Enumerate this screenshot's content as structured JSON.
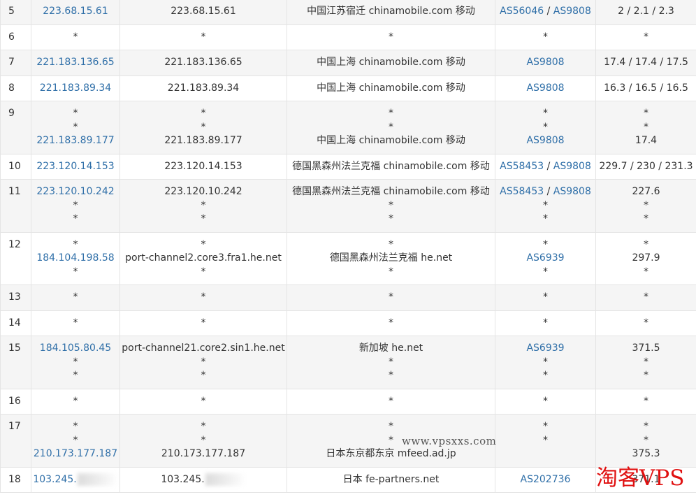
{
  "rows": [
    {
      "hop": "5",
      "ip": [
        "223.68.15.61"
      ],
      "host": [
        "223.68.15.61"
      ],
      "loc": [
        "中国江苏宿迁 chinamobile.com 移动"
      ],
      "asn": [
        [
          "AS56046",
          "AS9808"
        ]
      ],
      "time": [
        "2 / 2.1 / 2.3"
      ]
    },
    {
      "hop": "6",
      "ip": [
        "*"
      ],
      "host": [
        "*"
      ],
      "loc": [
        "*"
      ],
      "asn": [
        [
          "*"
        ]
      ],
      "time": [
        "*"
      ]
    },
    {
      "hop": "7",
      "ip": [
        "221.183.136.65"
      ],
      "host": [
        "221.183.136.65"
      ],
      "loc": [
        "中国上海 chinamobile.com 移动"
      ],
      "asn": [
        [
          "AS9808"
        ]
      ],
      "time": [
        "17.4 / 17.4 / 17.5"
      ]
    },
    {
      "hop": "8",
      "ip": [
        "221.183.89.34"
      ],
      "host": [
        "221.183.89.34"
      ],
      "loc": [
        "中国上海 chinamobile.com 移动"
      ],
      "asn": [
        [
          "AS9808"
        ]
      ],
      "time": [
        "16.3 / 16.5 / 16.5"
      ]
    },
    {
      "hop": "9",
      "ip": [
        "*",
        "*",
        "221.183.89.177"
      ],
      "host": [
        "*",
        "*",
        "221.183.89.177"
      ],
      "loc": [
        "*",
        "*",
        "中国上海 chinamobile.com 移动"
      ],
      "asn": [
        [
          "*"
        ],
        [
          "*"
        ],
        [
          "AS9808"
        ]
      ],
      "time": [
        "*",
        "*",
        "17.4"
      ]
    },
    {
      "hop": "10",
      "ip": [
        "223.120.14.153"
      ],
      "host": [
        "223.120.14.153"
      ],
      "loc": [
        "德国黑森州法兰克福 chinamobile.com 移动"
      ],
      "asn": [
        [
          "AS58453",
          "AS9808"
        ]
      ],
      "time": [
        "229.7 / 230 / 231.3"
      ]
    },
    {
      "hop": "11",
      "ip": [
        "223.120.10.242",
        "*",
        "*"
      ],
      "host": [
        "223.120.10.242",
        "*",
        "*"
      ],
      "loc": [
        "德国黑森州法兰克福 chinamobile.com 移动",
        "*",
        "*"
      ],
      "asn": [
        [
          "AS58453",
          "AS9808"
        ],
        [
          "*"
        ],
        [
          "*"
        ]
      ],
      "time": [
        "227.6",
        "*",
        "*"
      ]
    },
    {
      "hop": "12",
      "ip": [
        "*",
        "184.104.198.58",
        "*"
      ],
      "host": [
        "*",
        "port-channel2.core3.fra1.he.net",
        "*"
      ],
      "loc": [
        "*",
        "德国黑森州法兰克福 he.net",
        "*"
      ],
      "asn": [
        [
          "*"
        ],
        [
          "AS6939"
        ],
        [
          "*"
        ]
      ],
      "time": [
        "*",
        "297.9",
        "*"
      ]
    },
    {
      "hop": "13",
      "ip": [
        "*"
      ],
      "host": [
        "*"
      ],
      "loc": [
        "*"
      ],
      "asn": [
        [
          "*"
        ]
      ],
      "time": [
        "*"
      ]
    },
    {
      "hop": "14",
      "ip": [
        "*"
      ],
      "host": [
        "*"
      ],
      "loc": [
        "*"
      ],
      "asn": [
        [
          "*"
        ]
      ],
      "time": [
        "*"
      ]
    },
    {
      "hop": "15",
      "ip": [
        "184.105.80.45",
        "*",
        "*"
      ],
      "host": [
        "port-channel21.core2.sin1.he.net",
        "*",
        "*"
      ],
      "loc": [
        "新加坡 he.net",
        "*",
        "*"
      ],
      "asn": [
        [
          "AS6939"
        ],
        [
          "*"
        ],
        [
          "*"
        ]
      ],
      "time": [
        "371.5",
        "*",
        "*"
      ]
    },
    {
      "hop": "16",
      "ip": [
        "*"
      ],
      "host": [
        "*"
      ],
      "loc": [
        "*"
      ],
      "asn": [
        [
          "*"
        ]
      ],
      "time": [
        "*"
      ]
    },
    {
      "hop": "17",
      "ip": [
        "*",
        "*",
        "210.173.177.187"
      ],
      "host": [
        "*",
        "*",
        "210.173.177.187"
      ],
      "loc": [
        "*",
        "*",
        "日本东京都东京 mfeed.ad.jp"
      ],
      "asn": [
        [
          "*"
        ],
        [
          "*"
        ],
        [
          ""
        ]
      ],
      "time": [
        "*",
        "*",
        "375.3"
      ]
    },
    {
      "hop": "18",
      "ip": [
        "103.245."
      ],
      "host": [
        "103.245."
      ],
      "loc": [
        "日本 fe-partners.net"
      ],
      "asn": [
        [
          "AS202736"
        ]
      ],
      "time": [
        "371.1"
      ],
      "blurred": true
    }
  ],
  "asn_separator": " / ",
  "watermark_site": "www.vpsxxs.com",
  "watermark_brand": "淘客VPS",
  "colors": {
    "link": "#2f6fa8",
    "row_alt": "#f5f5f5",
    "border": "#e4e4e4",
    "watermark_brand": "#e01010"
  }
}
